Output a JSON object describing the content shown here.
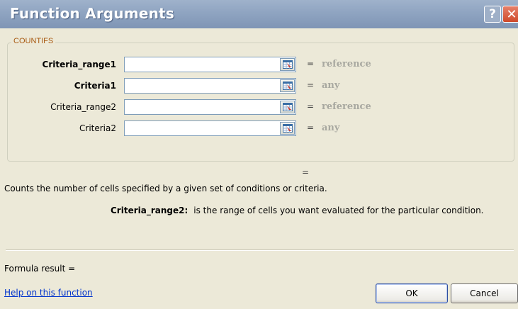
{
  "window": {
    "title": "Function Arguments",
    "help_button": "?",
    "close_button": "✕"
  },
  "function": {
    "name": "COUNTIFS",
    "arguments": [
      {
        "label": "Criteria_range1",
        "bold": true,
        "value": "",
        "hint": "reference"
      },
      {
        "label": "Criteria1",
        "bold": true,
        "value": "",
        "hint": "any"
      },
      {
        "label": "Criteria_range2",
        "bold": false,
        "value": "",
        "hint": "reference"
      },
      {
        "label": "Criteria2",
        "bold": false,
        "value": "",
        "hint": "any"
      }
    ],
    "equals_sign": "=",
    "result_equals": "=",
    "description": "Counts the number of cells specified by a given set of conditions or criteria.",
    "current_argument": {
      "name": "Criteria_range2:",
      "text": "is the range of cells you want evaluated for the particular condition."
    }
  },
  "footer": {
    "formula_result_label": "Formula result =",
    "help_link": "Help on this function",
    "ok_label": "OK",
    "cancel_label": "Cancel"
  },
  "icons": {
    "collapse_dialog": "collapse-dialog-icon"
  },
  "colors": {
    "titlebar": "#8fa4c1",
    "legend_text": "#a85a12",
    "hint_text": "#a8a8a0",
    "link": "#0033cc",
    "dialog_bg": "#ece9d8"
  }
}
